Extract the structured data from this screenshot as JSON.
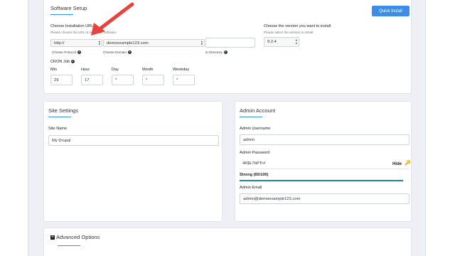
{
  "software_setup": {
    "title": "Software Setup",
    "quick_install": "Quick Install",
    "install_url_label": "Choose Installation URL",
    "install_url_sub": "Please choose the URL to install the software",
    "protocol_value": "http://",
    "domain_value": "demoexample123.com",
    "directory_value": "",
    "protocol_caption": "Choose Protocol",
    "domain_caption": "Choose Domain",
    "directory_caption": "In Directory",
    "version_label": "Choose the version you want to install",
    "version_sub": "Please select the version to install.",
    "version_value": "9.2.4",
    "cron_label": "CRON Job",
    "cron": [
      {
        "label": "Min",
        "value": "29"
      },
      {
        "label": "Hour",
        "value": "17"
      },
      {
        "label": "Day",
        "value": "*"
      },
      {
        "label": "Month",
        "value": "*"
      },
      {
        "label": "Weekday",
        "value": "*"
      }
    ]
  },
  "site_settings": {
    "title": "Site Settings",
    "site_name_label": "Site Name",
    "site_name_value": "My Drupal"
  },
  "admin_account": {
    "title": "Admin Account",
    "username_label": "Admin Username",
    "username_value": "admin",
    "password_label": "Admin Password",
    "password_value": "4K$L7bPTr#",
    "hide_label": "Hide",
    "strength_text": "Strong (65/100)",
    "strength_percent": 100,
    "email_label": "Admin Email",
    "email_value": "admin@demoexample123.com"
  },
  "advanced": {
    "title": "Advanced Options"
  },
  "colors": {
    "accent": "#3a8ee6",
    "strength": "#1f8a8a",
    "annotation_arrow": "#e8423f"
  },
  "icons": [
    "info-icon",
    "key-icon",
    "plus-icon",
    "dropdown-arrow-icon",
    "annotation-arrow"
  ]
}
